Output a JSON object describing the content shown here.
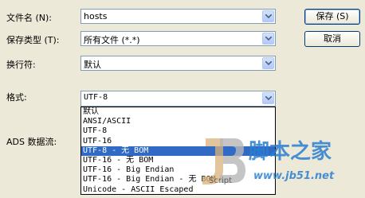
{
  "filename": {
    "label": "文件名 (N):",
    "value": "hosts"
  },
  "save_type": {
    "label": "保存类型 (T):",
    "value": "所有文件  (*.*)"
  },
  "newline": {
    "label": "换行符:",
    "value": "默认"
  },
  "encoding": {
    "label": "格式:",
    "value": "UTF-8",
    "options": [
      "默认",
      "ANSI/ASCII",
      "UTF-8",
      "UTF-16",
      "UTF-8 - 无 BOM",
      "UTF-16 - 无 BOM",
      "UTF-16 - Big Endian",
      "UTF-16 - Big Endian  - 无 BOM",
      "Unicode - ASCII Escaped"
    ],
    "selected_index": 4
  },
  "ads_label": "ADS 数据流:",
  "buttons": {
    "save": "保存 (S)",
    "cancel": "取消"
  },
  "watermark": {
    "text": "脚本之家",
    "url": "www.jb51.net",
    "extra": "Script"
  },
  "colors": {
    "selection": "#316ac5",
    "dialog_bg": "#ece9d8",
    "watermark": "#2a7fd0"
  }
}
